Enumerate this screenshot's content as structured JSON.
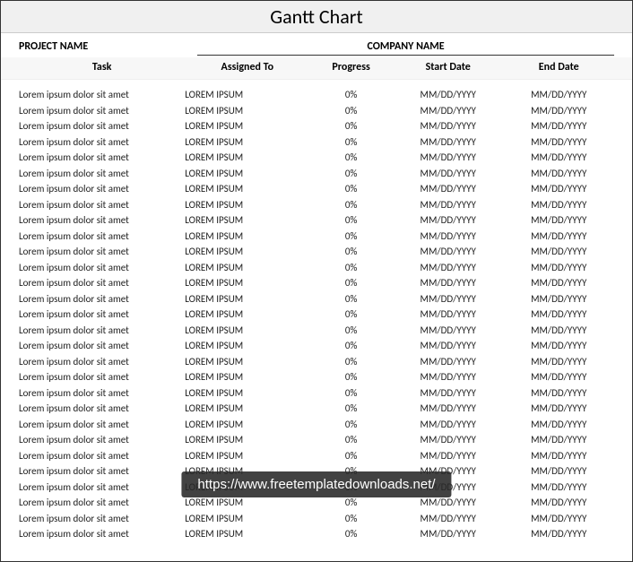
{
  "title": "Gantt Chart",
  "header": {
    "project_label": "PROJECT NAME",
    "company_label": "COMPANY NAME"
  },
  "columns": {
    "task": "Task",
    "assigned": "Assigned To",
    "progress": "Progress",
    "start": "Start Date",
    "end": "End Date"
  },
  "rows": [
    {
      "task": "Lorem ipsum dolor sit amet",
      "assigned": "LOREM IPSUM",
      "progress": "0%",
      "start": "MM/DD/YYYY",
      "end": "MM/DD/YYYY"
    },
    {
      "task": "Lorem ipsum dolor sit amet",
      "assigned": "LOREM IPSUM",
      "progress": "0%",
      "start": "MM/DD/YYYY",
      "end": "MM/DD/YYYY"
    },
    {
      "task": "Lorem ipsum dolor sit amet",
      "assigned": "LOREM IPSUM",
      "progress": "0%",
      "start": "MM/DD/YYYY",
      "end": "MM/DD/YYYY"
    },
    {
      "task": "Lorem ipsum dolor sit amet",
      "assigned": "LOREM IPSUM",
      "progress": "0%",
      "start": "MM/DD/YYYY",
      "end": "MM/DD/YYYY"
    },
    {
      "task": "Lorem ipsum dolor sit amet",
      "assigned": "LOREM IPSUM",
      "progress": "0%",
      "start": "MM/DD/YYYY",
      "end": "MM/DD/YYYY"
    },
    {
      "task": "Lorem ipsum dolor sit amet",
      "assigned": "LOREM IPSUM",
      "progress": "0%",
      "start": "MM/DD/YYYY",
      "end": "MM/DD/YYYY"
    },
    {
      "task": "Lorem ipsum dolor sit amet",
      "assigned": "LOREM IPSUM",
      "progress": "0%",
      "start": "MM/DD/YYYY",
      "end": "MM/DD/YYYY"
    },
    {
      "task": "Lorem ipsum dolor sit amet",
      "assigned": "LOREM IPSUM",
      "progress": "0%",
      "start": "MM/DD/YYYY",
      "end": "MM/DD/YYYY"
    },
    {
      "task": "Lorem ipsum dolor sit amet",
      "assigned": "LOREM IPSUM",
      "progress": "0%",
      "start": "MM/DD/YYYY",
      "end": "MM/DD/YYYY"
    },
    {
      "task": "Lorem ipsum dolor sit amet",
      "assigned": "LOREM IPSUM",
      "progress": "0%",
      "start": "MM/DD/YYYY",
      "end": "MM/DD/YYYY"
    },
    {
      "task": "Lorem ipsum dolor sit amet",
      "assigned": "LOREM IPSUM",
      "progress": "0%",
      "start": "MM/DD/YYYY",
      "end": "MM/DD/YYYY"
    },
    {
      "task": "Lorem ipsum dolor sit amet",
      "assigned": "LOREM IPSUM",
      "progress": "0%",
      "start": "MM/DD/YYYY",
      "end": "MM/DD/YYYY"
    },
    {
      "task": "Lorem ipsum dolor sit amet",
      "assigned": "LOREM IPSUM",
      "progress": "0%",
      "start": "MM/DD/YYYY",
      "end": "MM/DD/YYYY"
    },
    {
      "task": "Lorem ipsum dolor sit amet",
      "assigned": "LOREM IPSUM",
      "progress": "0%",
      "start": "MM/DD/YYYY",
      "end": "MM/DD/YYYY"
    },
    {
      "task": "Lorem ipsum dolor sit amet",
      "assigned": "LOREM IPSUM",
      "progress": "0%",
      "start": "MM/DD/YYYY",
      "end": "MM/DD/YYYY"
    },
    {
      "task": "Lorem ipsum dolor sit amet",
      "assigned": "LOREM IPSUM",
      "progress": "0%",
      "start": "MM/DD/YYYY",
      "end": "MM/DD/YYYY"
    },
    {
      "task": "Lorem ipsum dolor sit amet",
      "assigned": "LOREM IPSUM",
      "progress": "0%",
      "start": "MM/DD/YYYY",
      "end": "MM/DD/YYYY"
    },
    {
      "task": "Lorem ipsum dolor sit amet",
      "assigned": "LOREM IPSUM",
      "progress": "0%",
      "start": "MM/DD/YYYY",
      "end": "MM/DD/YYYY"
    },
    {
      "task": "Lorem ipsum dolor sit amet",
      "assigned": "LOREM IPSUM",
      "progress": "0%",
      "start": "MM/DD/YYYY",
      "end": "MM/DD/YYYY"
    },
    {
      "task": "Lorem ipsum dolor sit amet",
      "assigned": "LOREM IPSUM",
      "progress": "0%",
      "start": "MM/DD/YYYY",
      "end": "MM/DD/YYYY"
    },
    {
      "task": "Lorem ipsum dolor sit amet",
      "assigned": "LOREM IPSUM",
      "progress": "0%",
      "start": "MM/DD/YYYY",
      "end": "MM/DD/YYYY"
    },
    {
      "task": "Lorem ipsum dolor sit amet",
      "assigned": "LOREM IPSUM",
      "progress": "0%",
      "start": "MM/DD/YYYY",
      "end": "MM/DD/YYYY"
    },
    {
      "task": "Lorem ipsum dolor sit amet",
      "assigned": "LOREM IPSUM",
      "progress": "0%",
      "start": "MM/DD/YYYY",
      "end": "MM/DD/YYYY"
    },
    {
      "task": "Lorem ipsum dolor sit amet",
      "assigned": "LOREM IPSUM",
      "progress": "0%",
      "start": "MM/DD/YYYY",
      "end": "MM/DD/YYYY"
    },
    {
      "task": "Lorem ipsum dolor sit amet",
      "assigned": "LOREM IPSUM",
      "progress": "0%",
      "start": "MM/DD/YYYY",
      "end": "MM/DD/YYYY"
    },
    {
      "task": "Lorem ipsum dolor sit amet",
      "assigned": "LOREM IPSUM",
      "progress": "0%",
      "start": "MM/DD/YYYY",
      "end": "MM/DD/YYYY"
    },
    {
      "task": "Lorem ipsum dolor sit amet",
      "assigned": "LOREM IPSUM",
      "progress": "0%",
      "start": "MM/DD/YYYY",
      "end": "MM/DD/YYYY"
    },
    {
      "task": "Lorem ipsum dolor sit amet",
      "assigned": "LOREM IPSUM",
      "progress": "0%",
      "start": "MM/DD/YYYY",
      "end": "MM/DD/YYYY"
    },
    {
      "task": "Lorem ipsum dolor sit amet",
      "assigned": "LOREM IPSUM",
      "progress": "0%",
      "start": "MM/DD/YYYY",
      "end": "MM/DD/YYYY"
    }
  ],
  "watermark": "https://www.freetemplatedownloads.net/"
}
